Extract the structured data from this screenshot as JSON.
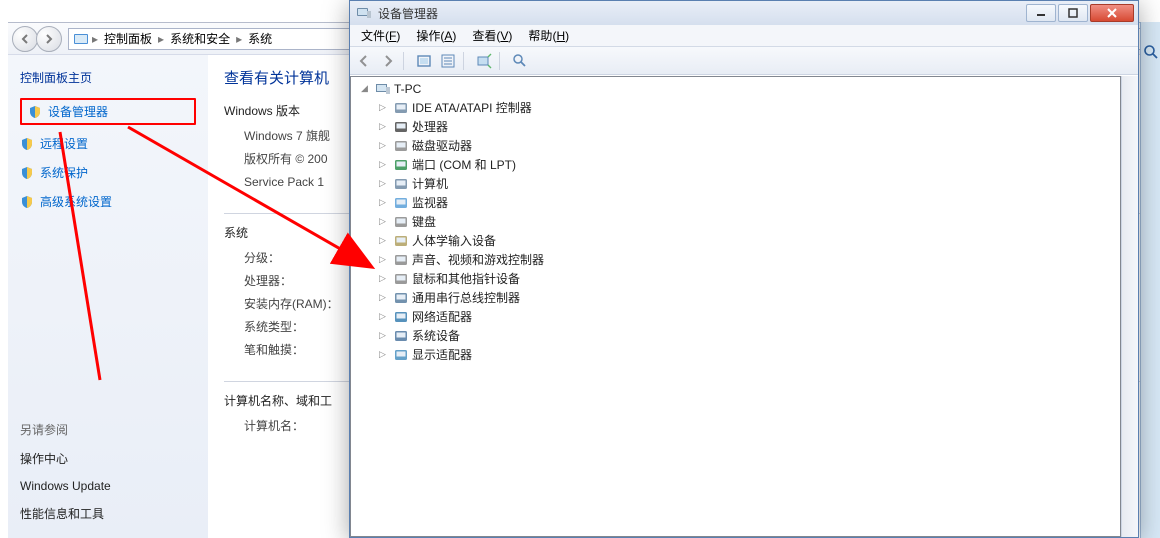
{
  "cp": {
    "breadcrumbs": [
      "控制面板",
      "系统和安全",
      "系统"
    ],
    "side": {
      "home": "控制面板主页",
      "links": [
        "设备管理器",
        "远程设置",
        "系统保护",
        "高级系统设置"
      ],
      "also_title": "另请参阅",
      "also": [
        "操作中心",
        "Windows Update",
        "性能信息和工具"
      ]
    },
    "main": {
      "heading": "查看有关计算机",
      "winver_title": "Windows 版本",
      "winver_lines": [
        "Windows 7 旗舰",
        "版权所有 © 200",
        "Service Pack 1"
      ],
      "sys_title": "系统",
      "sys_lines": [
        "分级：",
        "处理器：",
        "安装内存(RAM)：",
        "系统类型：",
        "笔和触摸："
      ],
      "name_title": "计算机名称、域和工",
      "name_lines": [
        "计算机名："
      ]
    }
  },
  "dm": {
    "title": "设备管理器",
    "menus": [
      {
        "label": "文件",
        "accel": "F"
      },
      {
        "label": "操作",
        "accel": "A"
      },
      {
        "label": "查看",
        "accel": "V"
      },
      {
        "label": "帮助",
        "accel": "H"
      }
    ],
    "root": "T-PC",
    "nodes": [
      "IDE ATA/ATAPI 控制器",
      "处理器",
      "磁盘驱动器",
      "端口 (COM 和 LPT)",
      "计算机",
      "监视器",
      "键盘",
      "人体学输入设备",
      "声音、视频和游戏控制器",
      "鼠标和其他指针设备",
      "通用串行总线控制器",
      "网络适配器",
      "系统设备",
      "显示适配器"
    ],
    "icon_colors": [
      "#6f8aa3",
      "#4a4a4a",
      "#8a8a8a",
      "#2f8f4f",
      "#6f8aa3",
      "#5aa0d8",
      "#8a8a8a",
      "#b0a060",
      "#888",
      "#888",
      "#5a7fa0",
      "#3a7fb0",
      "#5078a0",
      "#4a90c0"
    ]
  }
}
